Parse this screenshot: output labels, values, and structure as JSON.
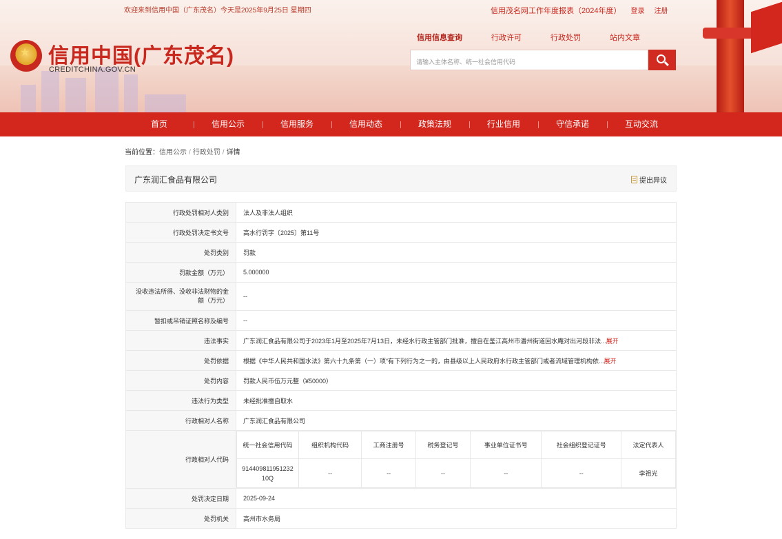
{
  "header": {
    "welcome": "欢迎来到信用中国（广东茂名）今天是2025年9月25日 星期四",
    "annual_report": "信用茂名网工作年度报表（2024年度）",
    "login": "登录",
    "register": "注册",
    "logo_title": "信用中国(广东茂名)",
    "logo_sub": "CREDITCHINA.GOV.CN",
    "brand_color": "#d3261d"
  },
  "search": {
    "tabs": [
      "信用信息查询",
      "行政许可",
      "行政处罚",
      "站内文章"
    ],
    "placeholder": "请输入主体名称、统一社会信用代码",
    "icon": "search-icon"
  },
  "nav": {
    "items": [
      "首页",
      "信用公示",
      "信用服务",
      "信用动态",
      "政策法规",
      "行业信用",
      "守信承诺",
      "互动交流"
    ]
  },
  "breadcrumb": {
    "prefix": "当前位置：",
    "items": [
      "信用公示",
      "行政处罚",
      "详情"
    ]
  },
  "title": {
    "company": "广东润汇食品有限公司",
    "objection": "提出异议"
  },
  "details": {
    "expand": "展开",
    "rows": [
      {
        "label": "行政处罚相对人类别",
        "value": "法人及非法人组织"
      },
      {
        "label": "行政处罚决定书文号",
        "value": "高水行罚字〔2025〕第11号"
      },
      {
        "label": "处罚类别",
        "value": "罚款"
      },
      {
        "label": "罚款金额（万元）",
        "value": "5.000000"
      },
      {
        "label": "没收违法所得、没收非法财物的金额（万元）",
        "value": "--"
      },
      {
        "label": "暂扣或吊销证照名称及编号",
        "value": "--"
      },
      {
        "label": "违法事实",
        "value": "广东润汇食品有限公司于2023年1月至2025年7月13日，未经水行政主管部门批准，擅自在鉴江高州市潘州街道回水庵对出河段非法..."
      },
      {
        "label": "处罚依据",
        "value": "根据《中华人民共和国水法》第六十九条第（一）项“有下列行为之一的，由县级以上人民政府水行政主管部门或者流域管理机构依..."
      },
      {
        "label": "处罚内容",
        "value": "罚款人民币伍万元整（¥50000）"
      },
      {
        "label": "违法行为类型",
        "value": "未经批准擅自取水"
      },
      {
        "label": "行政相对人名称",
        "value": "广东润汇食品有限公司"
      }
    ],
    "code_label": "行政相对人代码",
    "code_headers": [
      "统一社会信用代码",
      "组织机构代码",
      "工商注册号",
      "税务登记号",
      "事业单位证书号",
      "社会组织登记证号",
      "法定代表人"
    ],
    "code_values": [
      "91440981195123210Q",
      "--",
      "--",
      "--",
      "--",
      "--",
      "李祖光"
    ],
    "tail_rows": [
      {
        "label": "处罚决定日期",
        "value": "2025-09-24"
      },
      {
        "label": "处罚机关",
        "value": "高州市水务局"
      }
    ]
  }
}
